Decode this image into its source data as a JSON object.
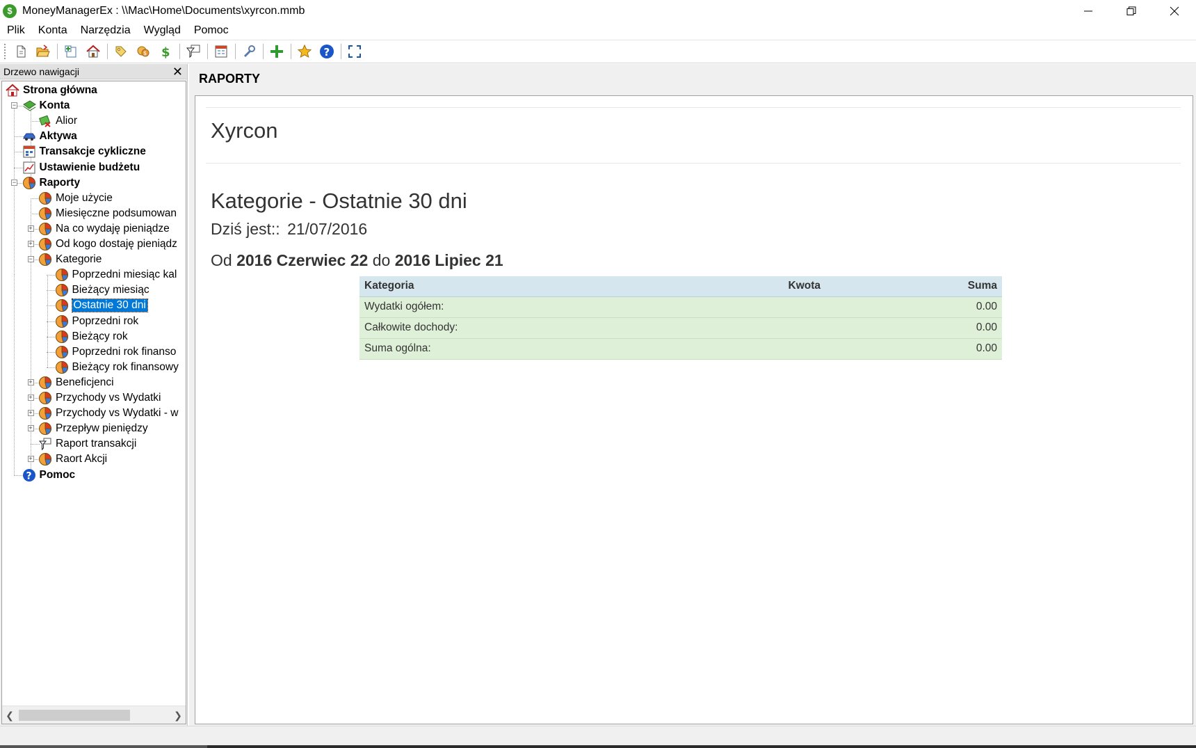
{
  "window": {
    "title": "MoneyManagerEx : \\\\Mac\\Home\\Documents\\xyrcon.mmb",
    "app_icon_glyph": "$"
  },
  "menu": [
    "Plik",
    "Konta",
    "Narzędzia",
    "Wygląd",
    "Pomoc"
  ],
  "toolbar": {
    "icons": [
      "new-database-icon",
      "open-database-icon",
      "new-account-icon",
      "home-icon",
      "organize-payees-icon",
      "organize-categories-icon",
      "currency-icon",
      "transaction-filter-icon",
      "budget-icon",
      "options-icon",
      "new-transaction-icon",
      "favorites-icon",
      "help-icon",
      "fullscreen-icon"
    ]
  },
  "nav": {
    "header": "Drzewo nawigacji",
    "items": [
      {
        "label": "Strona główna",
        "icon": "home-icon",
        "bold": true
      },
      {
        "label": "Konta",
        "icon": "accounts-icon",
        "bold": true
      },
      {
        "label": "Alior",
        "icon": "account-icon",
        "bold": false
      },
      {
        "label": "Aktywa",
        "icon": "car-icon",
        "bold": true
      },
      {
        "label": "Transakcje cykliczne",
        "icon": "calendar-icon",
        "bold": true
      },
      {
        "label": "Ustawienie budżetu",
        "icon": "budget-chart-icon",
        "bold": true
      },
      {
        "label": "Raporty",
        "icon": "pie-chart-icon",
        "bold": true
      },
      {
        "label": "Moje użycie",
        "icon": "pie-chart-icon",
        "bold": false
      },
      {
        "label": "Miesięczne podsumowan",
        "icon": "pie-chart-icon",
        "bold": false
      },
      {
        "label": "Na co wydaję pieniądze",
        "icon": "pie-chart-icon",
        "bold": false
      },
      {
        "label": "Od kogo dostaję pieniądz",
        "icon": "pie-chart-icon",
        "bold": false
      },
      {
        "label": "Kategorie",
        "icon": "pie-chart-icon",
        "bold": false
      },
      {
        "label": "Poprzedni miesiąc kal",
        "icon": "pie-chart-icon",
        "bold": false
      },
      {
        "label": "Bieżący miesiąc",
        "icon": "pie-chart-icon",
        "bold": false
      },
      {
        "label": "Ostatnie 30 dni",
        "icon": "pie-chart-icon",
        "bold": false,
        "selected": true
      },
      {
        "label": "Poprzedni rok",
        "icon": "pie-chart-icon",
        "bold": false
      },
      {
        "label": "Bieżący rok",
        "icon": "pie-chart-icon",
        "bold": false
      },
      {
        "label": "Poprzedni rok finanso",
        "icon": "pie-chart-icon",
        "bold": false
      },
      {
        "label": "Bieżący rok finansowy",
        "icon": "pie-chart-icon",
        "bold": false
      },
      {
        "label": "Beneficjenci",
        "icon": "pie-chart-icon",
        "bold": false
      },
      {
        "label": "Przychody vs Wydatki",
        "icon": "pie-chart-icon",
        "bold": false
      },
      {
        "label": "Przychody vs Wydatki - w",
        "icon": "pie-chart-icon",
        "bold": false
      },
      {
        "label": "Przepływ pieniędzy",
        "icon": "pie-chart-icon",
        "bold": false
      },
      {
        "label": "Raport transakcji",
        "icon": "filter-icon",
        "bold": false
      },
      {
        "label": "Raort Akcji",
        "icon": "pie-chart-icon",
        "bold": false
      },
      {
        "label": "Pomoc",
        "icon": "help-icon",
        "bold": true
      }
    ]
  },
  "main": {
    "header": "RAPORTY",
    "report": {
      "db_title": "Xyrcon",
      "subtitle": "Kategorie - Ostatnie 30 dni",
      "today_label": "Dziś jest::",
      "today_value": "21/07/2016",
      "range_from_word": "Od",
      "range_from": "2016 Czerwiec 22",
      "range_to_word": "do",
      "range_to": "2016 Lipiec 21",
      "table": {
        "headers": [
          "Kategoria",
          "Kwota",
          "Suma"
        ],
        "rows": [
          {
            "category": "Wydatki ogółem:",
            "amount": "",
            "total": "0.00"
          },
          {
            "category": "Całkowite dochody:",
            "amount": "",
            "total": "0.00"
          },
          {
            "category": "Suma ogólna:",
            "amount": "",
            "total": "0.00"
          }
        ]
      }
    }
  },
  "colors": {
    "selection": "#0078d7",
    "table_header": "#d5e6ee",
    "table_row": "#dff0d8"
  }
}
